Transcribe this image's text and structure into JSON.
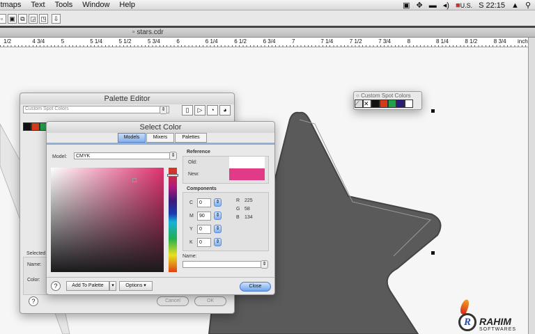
{
  "menubar": {
    "items": [
      "itmaps",
      "Text",
      "Tools",
      "Window",
      "Help"
    ],
    "clock": "S 22:15",
    "input_source": "U.S."
  },
  "document": {
    "tab_title": "stars.cdr"
  },
  "ruler": {
    "labels": [
      "1/2",
      "4 3/4",
      "5",
      "5 1/4",
      "5 1/2",
      "5 3/4",
      "6",
      "6 1/4",
      "6 1/2",
      "6 3/4",
      "7",
      "7 1/4",
      "7 1/2",
      "7 3/4",
      "8",
      "8 1/4",
      "8 1/2",
      "8 3/4"
    ],
    "unit": "inches"
  },
  "palette_editor": {
    "title": "Palette Editor",
    "palette_name": "Custom Spot Colors",
    "selected_label": "Selected",
    "name_label": "Name:",
    "color_label": "Color:",
    "cancel": "Cancel",
    "ok": "OK",
    "help": "?",
    "swatches": [
      "#111111",
      "#d23a1c",
      "#22a04a"
    ]
  },
  "select_color": {
    "title": "Select Color",
    "tabs": [
      "Models",
      "Mixers",
      "Palettes"
    ],
    "active_tab": "Models",
    "model_label": "Model:",
    "model_value": "CMYK",
    "reference_label": "Reference",
    "old_label": "Old:",
    "new_label": "New:",
    "old_color": "#ffffff",
    "new_color": "#e13a86",
    "components_label": "Components",
    "components": [
      {
        "k": "C",
        "v": "0"
      },
      {
        "k": "M",
        "v": "90"
      },
      {
        "k": "Y",
        "v": "0"
      },
      {
        "k": "K",
        "v": "0"
      }
    ],
    "rgb": [
      {
        "k": "R",
        "v": "225"
      },
      {
        "k": "G",
        "v": "58"
      },
      {
        "k": "B",
        "v": "134"
      }
    ],
    "name_label": "Name:",
    "name_value": "",
    "add_to_palette": "Add To Palette",
    "options": "Options",
    "close": "Close",
    "help": "?"
  },
  "spot_palette": {
    "title": "Custom Spot Colors",
    "swatches": [
      "#111111",
      "#d23a1c",
      "#22a04a",
      "#2a1c7a",
      "#ffffff"
    ]
  },
  "watermark": {
    "line1": "RAHIM",
    "line2": "SOFTWARES"
  }
}
